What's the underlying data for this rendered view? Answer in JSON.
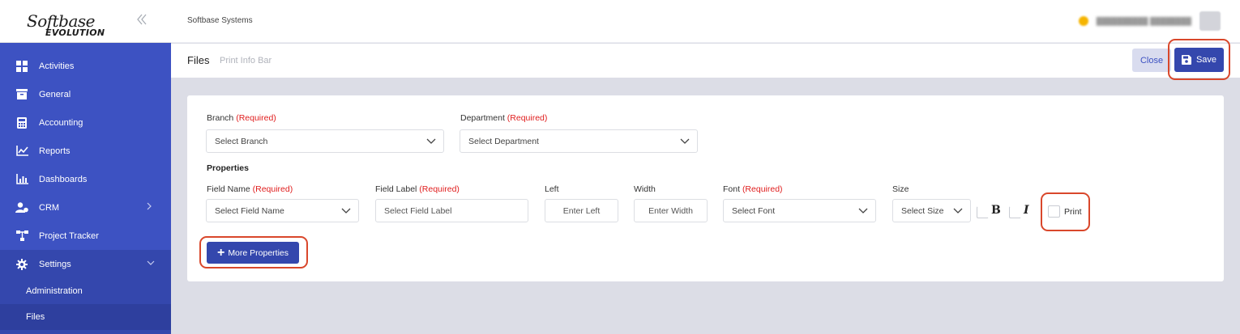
{
  "sidebar": {
    "logo_top": "Softbase",
    "logo_bottom": "EVOLUTION",
    "collapse_icon": "double-chevron-left-icon",
    "items": [
      {
        "label": "Activities",
        "icon": "grid-icon"
      },
      {
        "label": "General",
        "icon": "inbox-icon"
      },
      {
        "label": "Accounting",
        "icon": "calculator-icon"
      },
      {
        "label": "Reports",
        "icon": "line-chart-icon"
      },
      {
        "label": "Dashboards",
        "icon": "bar-chart-icon"
      },
      {
        "label": "CRM",
        "icon": "users-icon"
      },
      {
        "label": "Project Tracker",
        "icon": "sitemap-icon"
      },
      {
        "label": "Settings",
        "icon": "gear-icon"
      }
    ],
    "sub_items": [
      {
        "label": "Administration"
      },
      {
        "label": "Files"
      }
    ]
  },
  "header": {
    "company": "Softbase Systems"
  },
  "subheader": {
    "title": "Files",
    "crumb": "Print Info Bar",
    "close_label": "Close",
    "save_label": "Save"
  },
  "form": {
    "branch_label": "Branch",
    "department_label": "Department",
    "required": "(Required)",
    "branch_placeholder": "Select Branch",
    "department_placeholder": "Select Department",
    "properties_title": "Properties",
    "field_name_label": "Field Name",
    "field_label_label": "Field Label",
    "left_label": "Left",
    "width_label": "Width",
    "font_label": "Font",
    "size_label": "Size",
    "field_name_placeholder": "Select Field Name",
    "field_label_placeholder": "Select Field Label",
    "left_placeholder": "Enter Left",
    "width_placeholder": "Enter Width",
    "font_placeholder": "Select Font",
    "size_placeholder": "Select Size",
    "bold_glyph": "B",
    "italic_glyph": "I",
    "print_label": "Print",
    "more_properties_label": "More Properties"
  },
  "colors": {
    "sidebar": "#3d52c2",
    "primary": "#3447ad",
    "required": "#e01e1e",
    "highlight": "#d9472b"
  }
}
